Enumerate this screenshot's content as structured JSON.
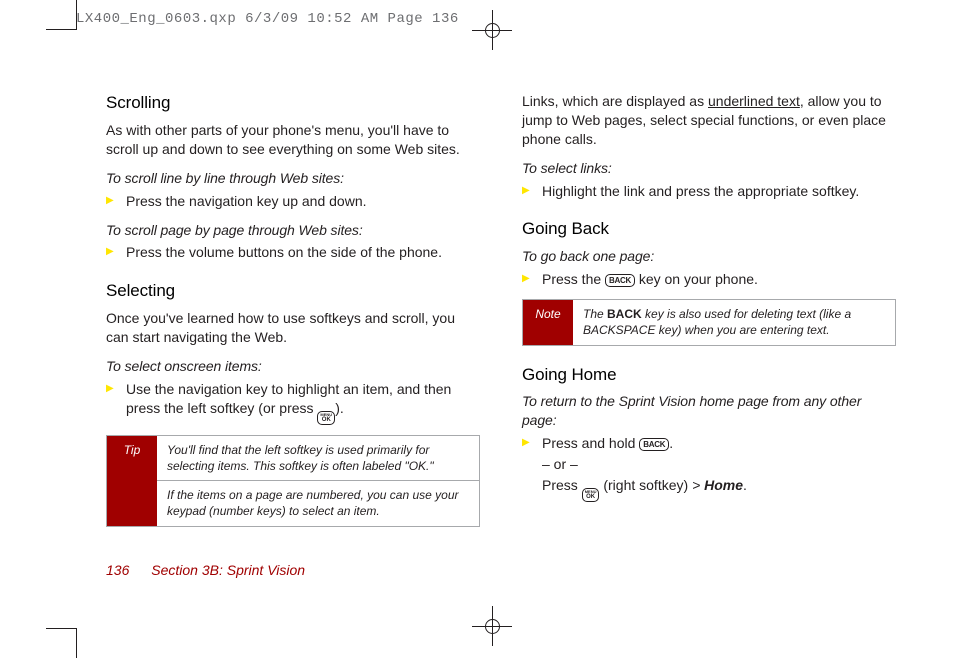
{
  "header": "LX400_Eng_0603.qxp  6/3/09  10:52 AM  Page 136",
  "left": {
    "h_scroll": "Scrolling",
    "scroll_body": "As with other parts of your phone's menu, you'll have to scroll up and down to see everything on some Web sites.",
    "scroll_lead1": "To scroll line by line through Web sites:",
    "scroll_li1": "Press the navigation key up and down.",
    "scroll_lead2": "To scroll page by page through Web sites:",
    "scroll_li2": "Press the volume buttons on the side of the phone.",
    "h_select": "Selecting",
    "select_body": "Once you've learned how to use softkeys and scroll, you can start navigating the Web.",
    "select_lead": "To select onscreen items:",
    "select_li_a": "Use the navigation key to highlight an item, and then press the left softkey (or press ",
    "select_li_b": ").",
    "tip_label": "Tip",
    "tip_p1": "You'll find that the left softkey is used primarily for selecting items. This softkey is often labeled \"OK.\"",
    "tip_p2": "If the items on a page are numbered, you can use your keypad (number keys) to select an item."
  },
  "right": {
    "links_a": "Links, which are displayed as ",
    "links_u": "underlined text",
    "links_b": ", allow you to jump to Web pages, select special functions, or even place phone calls.",
    "links_lead": "To select links:",
    "links_li": "Highlight the link and press the appropriate softkey.",
    "h_back": "Going Back",
    "back_lead": "To go back one page:",
    "back_li_a": "Press the ",
    "back_li_b": " key on your phone.",
    "note_label": "Note",
    "note_a": "The ",
    "note_bold": "BACK",
    "note_b": " key is also used for deleting text (like a BACKSPACE key) when you are entering text.",
    "h_home": "Going Home",
    "home_lead": "To return to the Sprint Vision home page from any other page:",
    "home_li1_a": "Press and hold ",
    "home_li1_b": ".",
    "home_or": "– or –",
    "home_li2_a": "Press ",
    "home_li2_b": " (right softkey) ",
    "home_li2_gt": ">",
    "home_li2_c": " Home",
    "home_li2_d": ".",
    "back_key": "BACK",
    "ok_top": "MENU",
    "ok_bot": "OK"
  },
  "footer": {
    "page": "136",
    "section": "Section 3B: Sprint Vision"
  }
}
